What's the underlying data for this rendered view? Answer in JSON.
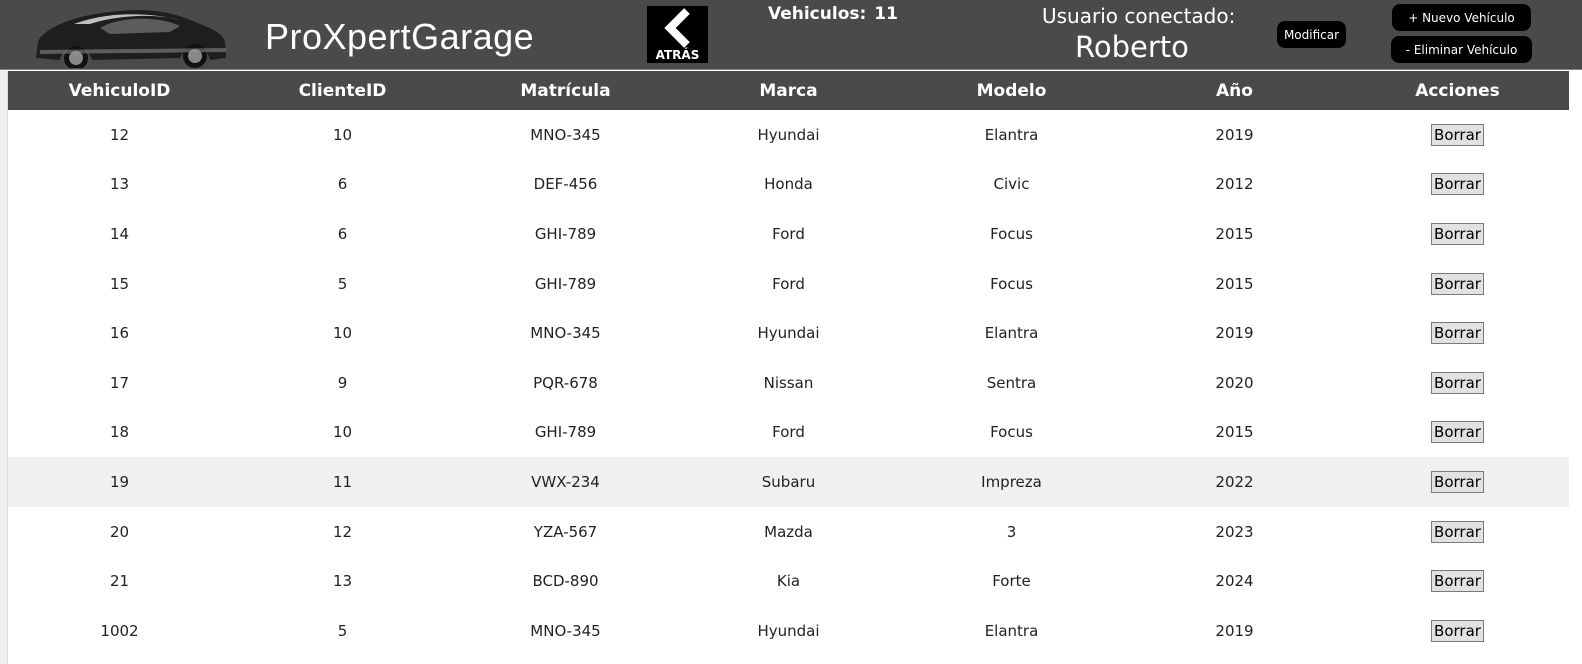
{
  "header": {
    "app_title": "ProXpertGarage",
    "back_label": "ATRÁS",
    "vehicle_count_label": "Vehiculos:",
    "vehicle_count_value": "11",
    "user_label": "Usuario conectado:",
    "user_name": "Roberto",
    "modify_label": "Modificar",
    "new_vehicle_label": "+ Nuevo Vehículo",
    "delete_vehicle_label": "- Eliminar Vehículo"
  },
  "table": {
    "columns": [
      "VehiculoID",
      "ClienteID",
      "Matrícula",
      "Marca",
      "Modelo",
      "Año",
      "Acciones"
    ],
    "delete_label": "Borrar",
    "rows": [
      {
        "vehiculo_id": "12",
        "cliente_id": "10",
        "matricula": "MNO-345",
        "marca": "Hyundai",
        "modelo": "Elantra",
        "anio": "2019"
      },
      {
        "vehiculo_id": "13",
        "cliente_id": "6",
        "matricula": "DEF-456",
        "marca": "Honda",
        "modelo": "Civic",
        "anio": "2012"
      },
      {
        "vehiculo_id": "14",
        "cliente_id": "6",
        "matricula": "GHI-789",
        "marca": "Ford",
        "modelo": "Focus",
        "anio": "2015"
      },
      {
        "vehiculo_id": "15",
        "cliente_id": "5",
        "matricula": "GHI-789",
        "marca": "Ford",
        "modelo": "Focus",
        "anio": "2015"
      },
      {
        "vehiculo_id": "16",
        "cliente_id": "10",
        "matricula": "MNO-345",
        "marca": "Hyundai",
        "modelo": "Elantra",
        "anio": "2019"
      },
      {
        "vehiculo_id": "17",
        "cliente_id": "9",
        "matricula": "PQR-678",
        "marca": "Nissan",
        "modelo": "Sentra",
        "anio": "2020"
      },
      {
        "vehiculo_id": "18",
        "cliente_id": "10",
        "matricula": "GHI-789",
        "marca": "Ford",
        "modelo": "Focus",
        "anio": "2015"
      },
      {
        "vehiculo_id": "19",
        "cliente_id": "11",
        "matricula": "VWX-234",
        "marca": "Subaru",
        "modelo": "Impreza",
        "anio": "2022"
      },
      {
        "vehiculo_id": "20",
        "cliente_id": "12",
        "matricula": "YZA-567",
        "marca": "Mazda",
        "modelo": "3",
        "anio": "2023"
      },
      {
        "vehiculo_id": "21",
        "cliente_id": "13",
        "matricula": "BCD-890",
        "marca": "Kia",
        "modelo": "Forte",
        "anio": "2024"
      },
      {
        "vehiculo_id": "1002",
        "cliente_id": "5",
        "matricula": "MNO-345",
        "marca": "Hyundai",
        "modelo": "Elantra",
        "anio": "2019"
      }
    ],
    "highlighted_row": 7
  },
  "icons": {
    "logo": "car-silhouette-logo",
    "back": "chevron-left-icon"
  },
  "colors": {
    "header_bg": "#4a4a4a",
    "button_bg": "#000000",
    "row_highlight": "#f0f0f0"
  }
}
